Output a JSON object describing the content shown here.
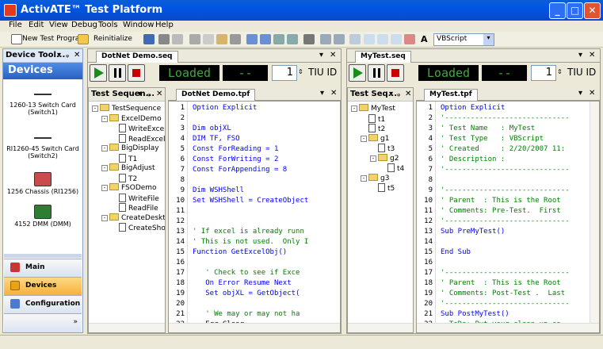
{
  "app": {
    "title": "ActivATE™ Test Platform"
  },
  "menu": [
    "File",
    "Edit",
    "View",
    "Debug",
    "Tools",
    "Window",
    "Help"
  ],
  "toolbar": {
    "new_label": "New Test Program",
    "reinit_label": "Reinitialize",
    "lang_value": "VBScript"
  },
  "devices_panel": {
    "tab": "Device Tool...",
    "header": "Devices",
    "items": [
      {
        "label": "1260-13 Switch Card (Switch1)",
        "icon": "switch-card-icon"
      },
      {
        "label": "RI1260-45 Switch Card (Switch2)",
        "icon": "switch-card-icon"
      },
      {
        "label": "1256 Chassis (RI1256)",
        "icon": "chassis-icon"
      },
      {
        "label": "4152 DMM (DMM)",
        "icon": "dmm-icon"
      }
    ],
    "nav": [
      {
        "label": "Main",
        "icon": "main-icon"
      },
      {
        "label": "Devices",
        "icon": "devices-icon"
      },
      {
        "label": "Configuration",
        "icon": "configuration-icon"
      }
    ]
  },
  "left_doc": {
    "tab": "DotNet Demo.seq",
    "status": "Loaded",
    "dash": "--",
    "count": "1",
    "tiu": "TIU ID",
    "tree_tab": "Test Sequen...",
    "tree": [
      {
        "label": "TestSequence",
        "type": "folder",
        "level": 0,
        "pm": "-"
      },
      {
        "label": "ExcelDemo",
        "type": "folder",
        "level": 1,
        "pm": "-"
      },
      {
        "label": "WriteExcel",
        "type": "file",
        "level": 2
      },
      {
        "label": "ReadExcel",
        "type": "file",
        "level": 2
      },
      {
        "label": "BigDisplay",
        "type": "folder",
        "level": 1,
        "pm": "-"
      },
      {
        "label": "T1",
        "type": "file",
        "level": 2
      },
      {
        "label": "BigAdjust",
        "type": "folder",
        "level": 1,
        "pm": "-"
      },
      {
        "label": "T2",
        "type": "file",
        "level": 2
      },
      {
        "label": "FSODemo",
        "type": "folder",
        "level": 1,
        "pm": "-"
      },
      {
        "label": "WriteFile",
        "type": "file",
        "level": 2
      },
      {
        "label": "ReadFile",
        "type": "file",
        "level": 2
      },
      {
        "label": "CreateDesktop",
        "type": "folder",
        "level": 1,
        "pm": "-"
      },
      {
        "label": "CreateSho",
        "type": "file",
        "level": 2
      }
    ],
    "code_tab": "DotNet Demo.tpf",
    "code": [
      {
        "n": "1",
        "t": "Option Explicit",
        "c": "kw"
      },
      {
        "n": "2",
        "t": "",
        "c": "tx"
      },
      {
        "n": "3",
        "t": "Dim objXL",
        "c": "kw"
      },
      {
        "n": "4",
        "t": "DIM TF, FSO",
        "c": "kw"
      },
      {
        "n": "5",
        "t": "Const ForReading = 1",
        "c": "kw"
      },
      {
        "n": "6",
        "t": "Const ForWriting = 2",
        "c": "kw"
      },
      {
        "n": "7",
        "t": "Const ForAppending = 8",
        "c": "kw"
      },
      {
        "n": "8",
        "t": "",
        "c": "tx"
      },
      {
        "n": "9",
        "t": "Dim WSHShell",
        "c": "kw"
      },
      {
        "n": "10",
        "t": "Set WSHShell = CreateObject",
        "c": "kw"
      },
      {
        "n": "11",
        "t": "",
        "c": "tx"
      },
      {
        "n": "12",
        "t": "",
        "c": "tx"
      },
      {
        "n": "13",
        "t": "' If excel is already runn",
        "c": "cm"
      },
      {
        "n": "14",
        "t": "' This is not used.  Only I",
        "c": "cm"
      },
      {
        "n": "15",
        "t": "Function GetExcelObj()",
        "c": "kw"
      },
      {
        "n": "16",
        "t": "",
        "c": "tx"
      },
      {
        "n": "17",
        "t": "   ' Check to see if Exce",
        "c": "cm"
      },
      {
        "n": "18",
        "t": "   On Error Resume Next",
        "c": "kw"
      },
      {
        "n": "19",
        "t": "   Set objXL = GetObject(",
        "c": "kw"
      },
      {
        "n": "20",
        "t": "",
        "c": "tx"
      },
      {
        "n": "21",
        "t": "   ' We may or may not ha",
        "c": "cm"
      },
      {
        "n": "22",
        "t": "   Err.Clear",
        "c": "tx"
      }
    ]
  },
  "right_doc": {
    "tab": "MyTest.seq",
    "status": "Loaded",
    "dash": "--",
    "count": "1",
    "tiu": "TIU ID",
    "tree_tab": "Test Seq...",
    "tree": [
      {
        "label": "MyTest",
        "type": "folder",
        "level": 0,
        "pm": "-"
      },
      {
        "label": "t1",
        "type": "file",
        "level": 1
      },
      {
        "label": "t2",
        "type": "file",
        "level": 1
      },
      {
        "label": "g1",
        "type": "folder",
        "level": 1,
        "pm": "-"
      },
      {
        "label": "t3",
        "type": "file",
        "level": 2
      },
      {
        "label": "g2",
        "type": "folder",
        "level": 2,
        "pm": "-"
      },
      {
        "label": "t4",
        "type": "file",
        "level": 3
      },
      {
        "label": "g3",
        "type": "folder",
        "level": 1,
        "pm": "-"
      },
      {
        "label": "t5",
        "type": "file",
        "level": 2
      }
    ],
    "code_tab": "MyTest.tpf",
    "code": [
      {
        "n": "1",
        "t": "Option Explicit",
        "c": "kw"
      },
      {
        "n": "2",
        "t": "'-----------------------------",
        "c": "cm"
      },
      {
        "n": "3",
        "t": "' Test Name   : MyTest",
        "c": "cm"
      },
      {
        "n": "4",
        "t": "' Test Type   : VBScript",
        "c": "cm"
      },
      {
        "n": "5",
        "t": "' Created     : 2/20/2007 11:",
        "c": "cm"
      },
      {
        "n": "6",
        "t": "' Description :",
        "c": "cm"
      },
      {
        "n": "7",
        "t": "'-----------------------------",
        "c": "cm"
      },
      {
        "n": "8",
        "t": "",
        "c": "tx"
      },
      {
        "n": "9",
        "t": "'-----------------------------",
        "c": "cm"
      },
      {
        "n": "10",
        "t": "' Parent  : This is the Root",
        "c": "cm"
      },
      {
        "n": "11",
        "t": "' Comments: Pre-Test.  First",
        "c": "cm"
      },
      {
        "n": "12",
        "t": "'-----------------------------",
        "c": "cm"
      },
      {
        "n": "13",
        "t": "Sub PreMyTest()",
        "c": "kw"
      },
      {
        "n": "14",
        "t": "",
        "c": "tx"
      },
      {
        "n": "15",
        "t": "End Sub",
        "c": "kw"
      },
      {
        "n": "16",
        "t": "",
        "c": "tx"
      },
      {
        "n": "17",
        "t": "'-----------------------------",
        "c": "cm"
      },
      {
        "n": "18",
        "t": "' Parent  : This is the Root",
        "c": "cm"
      },
      {
        "n": "19",
        "t": "' Comments: Post-Test .  Last",
        "c": "cm"
      },
      {
        "n": "20",
        "t": "'-----------------------------",
        "c": "cm"
      },
      {
        "n": "21",
        "t": "Sub PostMyTest()",
        "c": "kw"
      },
      {
        "n": "22",
        "t": "  ToDo: Put your clean-up co",
        "c": "cm"
      }
    ]
  }
}
